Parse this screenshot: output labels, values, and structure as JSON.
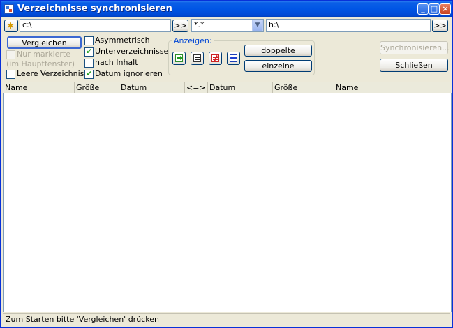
{
  "window": {
    "title": "Verzeichnisse synchronisieren",
    "minimize": "_",
    "maximize": "□",
    "close": "×"
  },
  "paths": {
    "left": "c:\\",
    "mask": "*.*",
    "right": "h:\\",
    "browse_label": ">>"
  },
  "buttons": {
    "compare": "Vergleichen",
    "synchronize": "Synchronisieren...",
    "close": "Schließen",
    "duplicates": "doppelte",
    "singles": "einzelne"
  },
  "options": {
    "marked_only": "Nur markierte",
    "in_main_window": "(im Hauptfenster)",
    "empty_dirs": "Leere Verzeichnisse",
    "asymmetric": "Asymmetrisch",
    "subdirs": "Unterverzeichnisse",
    "by_content": "nach Inhalt",
    "ignore_date": "Datum ignorieren"
  },
  "show": {
    "title": "Anzeigen:"
  },
  "columns": [
    "Name",
    "Größe",
    "Datum",
    "<=>",
    "Datum",
    "Größe",
    "Name"
  ],
  "status": "Zum Starten bitte 'Vergleichen' drücken"
}
